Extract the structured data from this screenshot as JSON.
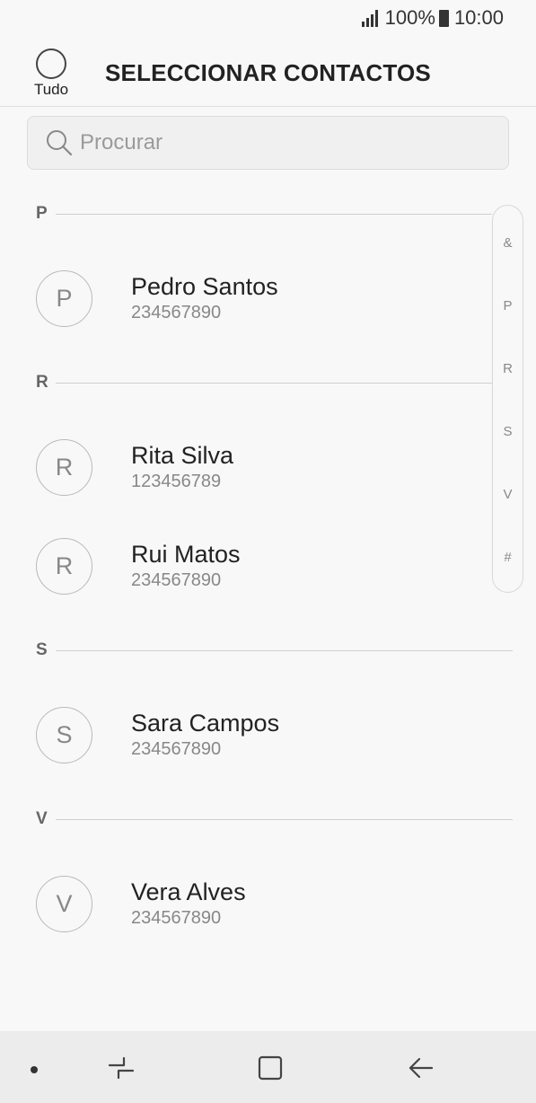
{
  "status": {
    "battery": "100%",
    "time": "10:00"
  },
  "header": {
    "select_all_label": "Tudo",
    "title": "SELECCIONAR CONTACTOS"
  },
  "search": {
    "placeholder": "Procurar"
  },
  "sections": [
    {
      "letter": "P",
      "contacts": [
        {
          "initial": "P",
          "name": "Pedro Santos",
          "number": "234567890"
        }
      ]
    },
    {
      "letter": "R",
      "contacts": [
        {
          "initial": "R",
          "name": "Rita Silva",
          "number": "123456789"
        },
        {
          "initial": "R",
          "name": "Rui Matos",
          "number": "234567890"
        }
      ]
    },
    {
      "letter": "S",
      "contacts": [
        {
          "initial": "S",
          "name": "Sara Campos",
          "number": "234567890"
        }
      ]
    },
    {
      "letter": "V",
      "contacts": [
        {
          "initial": "V",
          "name": "Vera Alves",
          "number": "234567890"
        }
      ]
    }
  ],
  "index_bar": [
    "&",
    "P",
    "R",
    "S",
    "V",
    "#"
  ],
  "navbar": {
    "icons": [
      "dot-icon",
      "recent-apps-icon",
      "home-icon",
      "back-icon"
    ]
  }
}
